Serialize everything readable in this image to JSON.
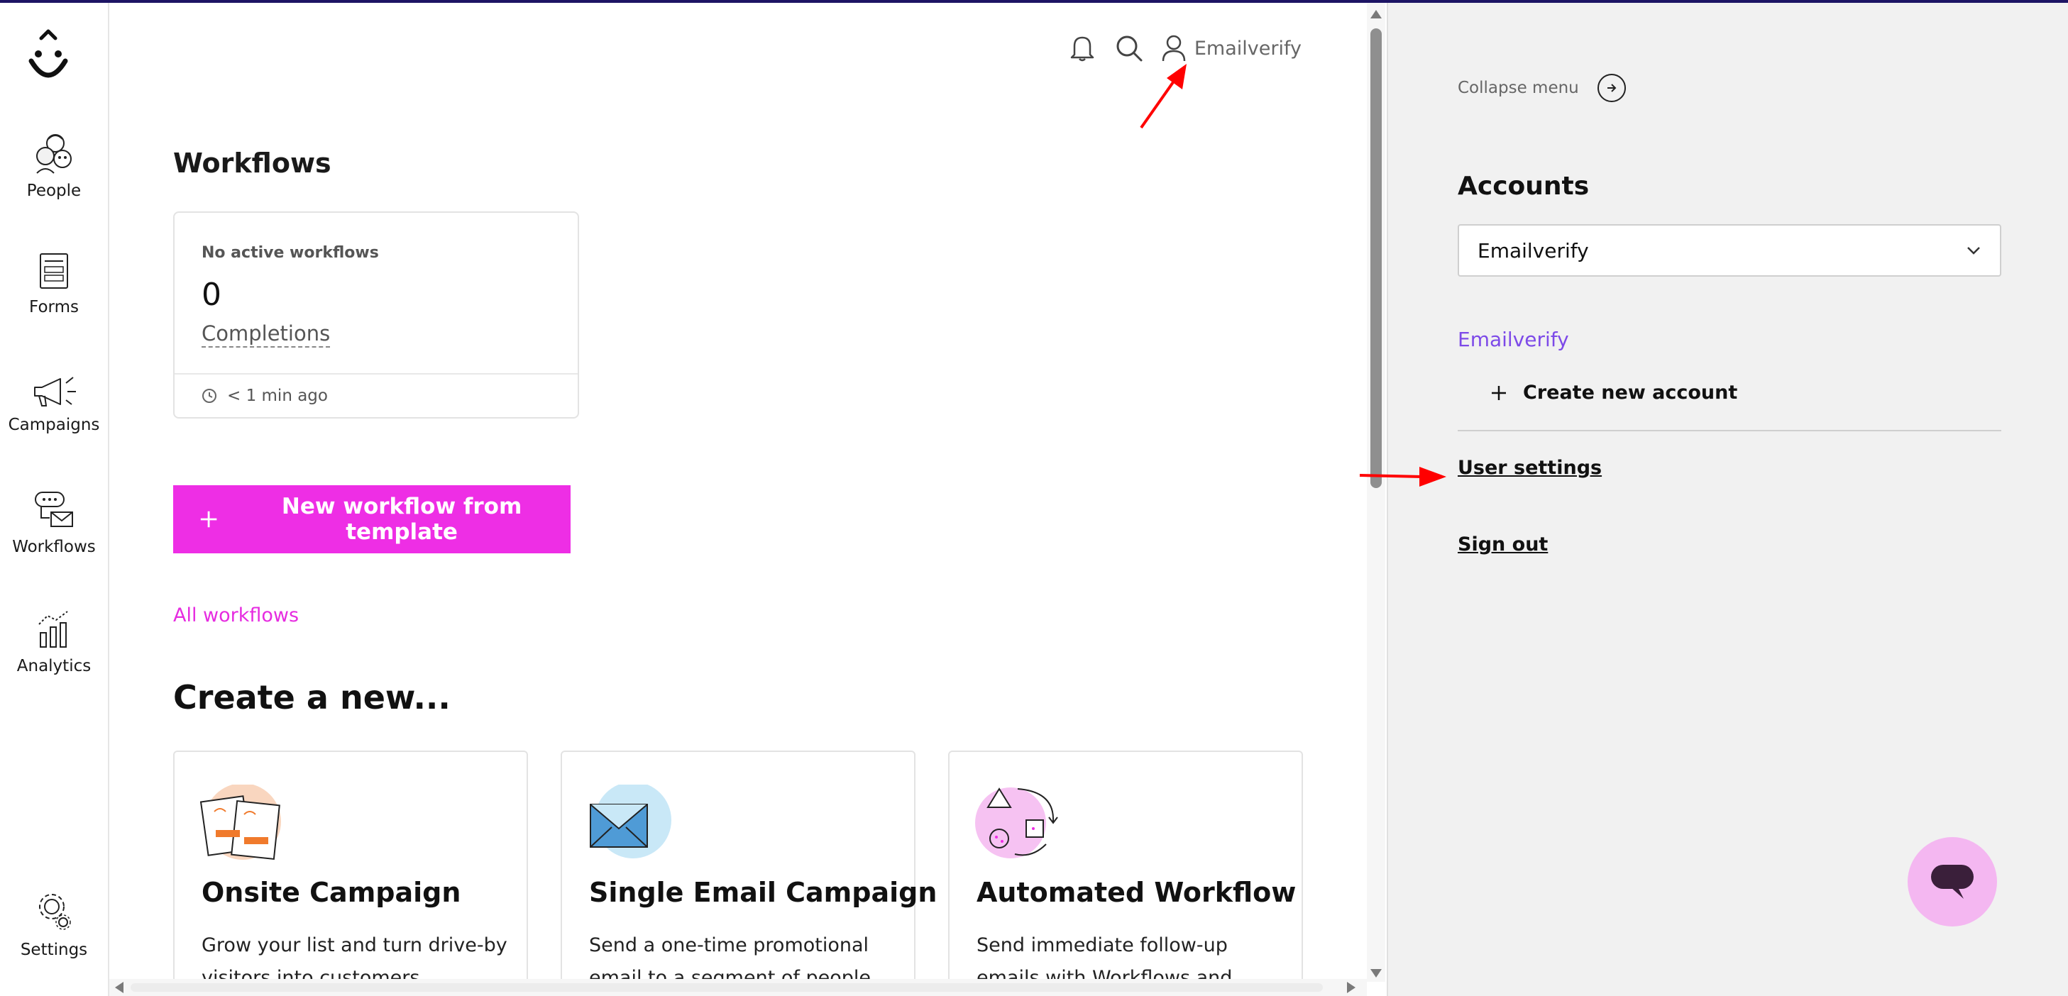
{
  "nav": {
    "items": [
      {
        "label": "People",
        "icon": "people-icon"
      },
      {
        "label": "Forms",
        "icon": "forms-icon"
      },
      {
        "label": "Campaigns",
        "icon": "campaigns-icon"
      },
      {
        "label": "Workflows",
        "icon": "workflows-icon"
      },
      {
        "label": "Analytics",
        "icon": "analytics-icon"
      }
    ],
    "settings_label": "Settings"
  },
  "header": {
    "user_name": "Emailverify",
    "icons": [
      "bell-icon",
      "search-icon",
      "user-icon"
    ]
  },
  "workflows": {
    "title": "Workflows",
    "card": {
      "status": "No active workflows",
      "count": "0",
      "metric": "Completions",
      "updated": "< 1 min ago"
    },
    "new_button": "New workflow from template",
    "all_link": "All workflows"
  },
  "create": {
    "title": "Create a new...",
    "cards": [
      {
        "title": "Onsite Campaign",
        "desc": "Grow your list and turn drive-by visitors into customers"
      },
      {
        "title": "Single Email Campaign",
        "desc": "Send a one-time promotional email to a segment of people"
      },
      {
        "title": "Automated Workflow",
        "desc": "Send immediate follow-up emails with Workflows and Rules"
      }
    ]
  },
  "panel": {
    "collapse_label": "Collapse menu",
    "accounts_title": "Accounts",
    "account_selected": "Emailverify",
    "account_current": "Emailverify",
    "create_account": "Create new account",
    "user_settings": "User settings",
    "sign_out": "Sign out"
  },
  "colors": {
    "brand_magenta": "#ee2ee5",
    "link_magenta": "#e62ce0",
    "account_purple": "#7d4ae8",
    "chat_pink": "#f4b7f1",
    "annotation_red": "#ff0000"
  }
}
